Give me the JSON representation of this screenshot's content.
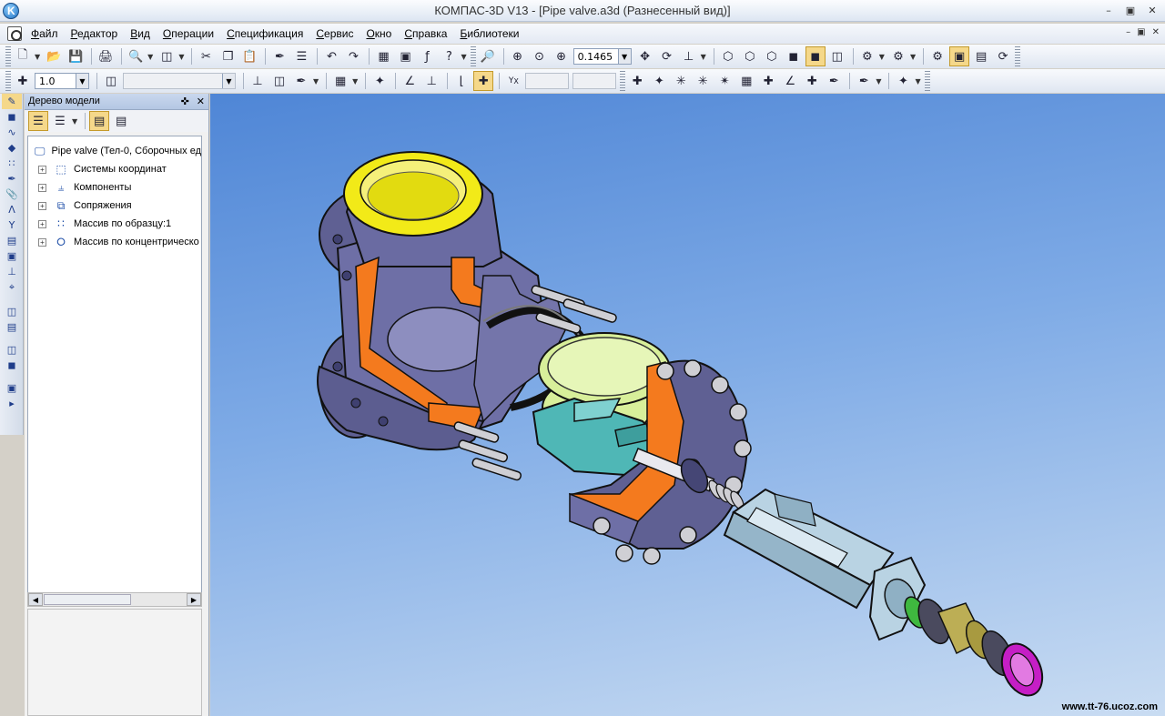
{
  "window": {
    "title": "КОМПАС-3D V13 - [Pipe valve.a3d (Разнесенный вид)]",
    "app_icon_letter": "K"
  },
  "menu": {
    "items": [
      "Файл",
      "Редактор",
      "Вид",
      "Операции",
      "Спецификация",
      "Сервис",
      "Окно",
      "Справка",
      "Библиотеки"
    ]
  },
  "toolbar": {
    "zoom_value": "0.1465",
    "step_value": "1.0",
    "coord_x_label": "Y",
    "coord_x_sub": "X"
  },
  "tree": {
    "header": "Дерево модели",
    "root": "Pipe valve (Тел-0, Сборочных ед",
    "children": [
      {
        "label": "Системы координат",
        "icon": "coordinate-system-icon"
      },
      {
        "label": "Компоненты",
        "icon": "components-icon"
      },
      {
        "label": "Сопряжения",
        "icon": "mates-icon"
      },
      {
        "label": "Массив по образцу:1",
        "icon": "pattern-array-icon"
      },
      {
        "label": "Массив по концентрическо",
        "icon": "concentric-array-icon"
      }
    ]
  },
  "viewport": {
    "watermark": "www.tt-76.ucoz.com",
    "background_top": "#4f86d6",
    "background_bottom": "#c9dcf2"
  },
  "colors": {
    "body": "#6e6fa6",
    "section_cut": "#f47a1e",
    "flange_yellow": "#f2ea18",
    "disc": "#d8ef9a",
    "bracket": "#4fb7b6",
    "actuator": "#b9d3e3",
    "green_part": "#3fb83f",
    "olive_part": "#bcae55",
    "magenta_ring": "#c51ec5"
  }
}
